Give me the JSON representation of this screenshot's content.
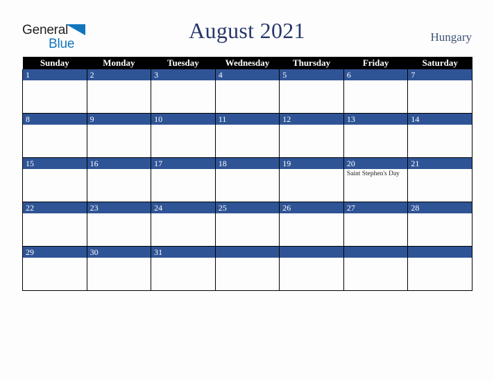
{
  "brand": {
    "name_part1": "General",
    "name_part2": "Blue",
    "triangle_color": "#1275bc",
    "text_color": "#231f20"
  },
  "header": {
    "title": "August 2021",
    "region": "Hungary",
    "title_color": "#28386b",
    "region_color": "#3c5075"
  },
  "calendar": {
    "header_background": "#000000",
    "daynum_background": "#2f5496",
    "cell_background": "#fdfdfd",
    "weekday_headers": [
      "Sunday",
      "Monday",
      "Tuesday",
      "Wednesday",
      "Thursday",
      "Friday",
      "Saturday"
    ],
    "weeks": [
      [
        {
          "day": "1",
          "events": []
        },
        {
          "day": "2",
          "events": []
        },
        {
          "day": "3",
          "events": []
        },
        {
          "day": "4",
          "events": []
        },
        {
          "day": "5",
          "events": []
        },
        {
          "day": "6",
          "events": []
        },
        {
          "day": "7",
          "events": []
        }
      ],
      [
        {
          "day": "8",
          "events": []
        },
        {
          "day": "9",
          "events": []
        },
        {
          "day": "10",
          "events": []
        },
        {
          "day": "11",
          "events": []
        },
        {
          "day": "12",
          "events": []
        },
        {
          "day": "13",
          "events": []
        },
        {
          "day": "14",
          "events": []
        }
      ],
      [
        {
          "day": "15",
          "events": []
        },
        {
          "day": "16",
          "events": []
        },
        {
          "day": "17",
          "events": []
        },
        {
          "day": "18",
          "events": []
        },
        {
          "day": "19",
          "events": []
        },
        {
          "day": "20",
          "events": [
            "Saint Stephen's Day"
          ]
        },
        {
          "day": "21",
          "events": []
        }
      ],
      [
        {
          "day": "22",
          "events": []
        },
        {
          "day": "23",
          "events": []
        },
        {
          "day": "24",
          "events": []
        },
        {
          "day": "25",
          "events": []
        },
        {
          "day": "26",
          "events": []
        },
        {
          "day": "27",
          "events": []
        },
        {
          "day": "28",
          "events": []
        }
      ],
      [
        {
          "day": "29",
          "events": []
        },
        {
          "day": "30",
          "events": []
        },
        {
          "day": "31",
          "events": []
        },
        {
          "day": "",
          "events": []
        },
        {
          "day": "",
          "events": []
        },
        {
          "day": "",
          "events": []
        },
        {
          "day": "",
          "events": []
        }
      ]
    ]
  }
}
